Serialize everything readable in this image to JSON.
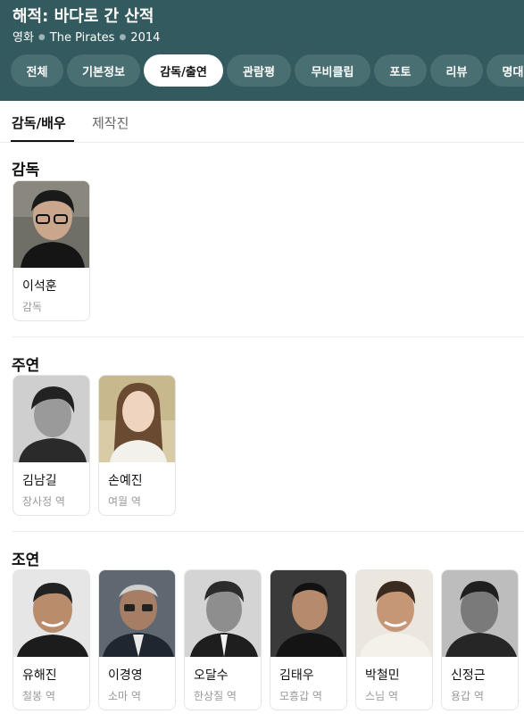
{
  "header": {
    "title": "해적: 바다로 간 산적",
    "meta": [
      "영화",
      "The Pirates",
      "2014"
    ]
  },
  "tabs": [
    {
      "label": "전체"
    },
    {
      "label": "기본정보"
    },
    {
      "label": "감독/출연",
      "active": true
    },
    {
      "label": "관람평"
    },
    {
      "label": "무비클립"
    },
    {
      "label": "포토"
    },
    {
      "label": "리뷰"
    },
    {
      "label": "명대"
    }
  ],
  "subtabs": [
    {
      "label": "감독/배우",
      "active": true
    },
    {
      "label": "제작진"
    }
  ],
  "sections": [
    {
      "title": "감독",
      "people": [
        {
          "name": "이석훈",
          "role": "감독"
        }
      ]
    },
    {
      "title": "주연",
      "people": [
        {
          "name": "김남길",
          "role": "장사정 역"
        },
        {
          "name": "손예진",
          "role": "여월 역"
        }
      ]
    },
    {
      "title": "조연",
      "people": [
        {
          "name": "유해진",
          "role": "철봉 역"
        },
        {
          "name": "이경영",
          "role": "소마 역"
        },
        {
          "name": "오달수",
          "role": "한상질 역"
        },
        {
          "name": "김태우",
          "role": "모흥갑 역"
        },
        {
          "name": "박철민",
          "role": "스님 역"
        },
        {
          "name": "신정근",
          "role": "용갑 역"
        }
      ]
    }
  ],
  "colors": {
    "header_bg": "#335a5e",
    "tab_bg": "#4a6f73",
    "tab_active_bg": "#ffffff"
  }
}
